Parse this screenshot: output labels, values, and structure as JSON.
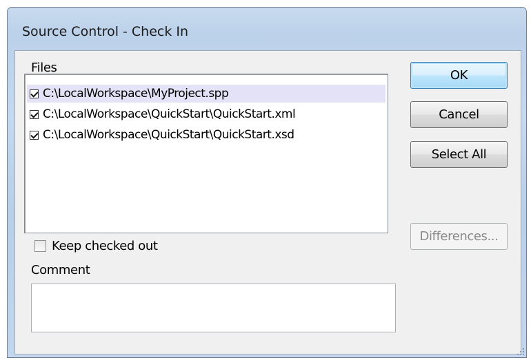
{
  "window": {
    "title": "Source Control - Check In"
  },
  "files": {
    "label": "Files",
    "items": [
      {
        "path": "C:\\LocalWorkspace\\MyProject.spp",
        "checked": true,
        "selected": true
      },
      {
        "path": "C:\\LocalWorkspace\\QuickStart\\QuickStart.xml",
        "checked": true,
        "selected": false
      },
      {
        "path": "C:\\LocalWorkspace\\QuickStart\\QuickStart.xsd",
        "checked": true,
        "selected": false
      }
    ]
  },
  "options": {
    "keep_checked_out_label": "Keep checked out",
    "keep_checked_out": false
  },
  "comment": {
    "label": "Comment",
    "value": ""
  },
  "buttons": {
    "ok": "OK",
    "cancel": "Cancel",
    "select_all": "Select All",
    "differences": "Differences..."
  },
  "icons": {
    "checkbox": "checkbox-icon",
    "resize_grip": "resize-grip-icon"
  },
  "colors": {
    "title_bar": "#bcd1ea",
    "selection": "#e4e2f6",
    "default_button_border": "#3c7fb1"
  }
}
